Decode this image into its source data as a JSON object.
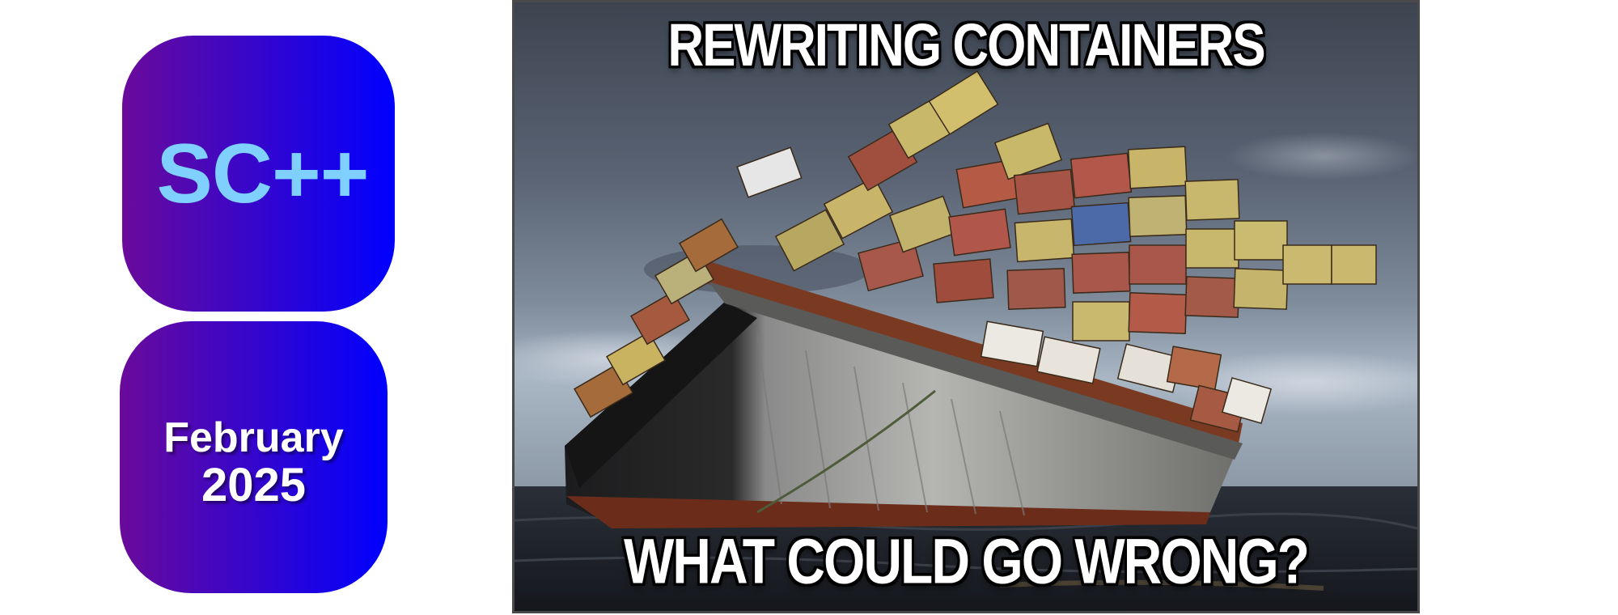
{
  "logo": {
    "text": "SC++",
    "text_color": "#7fd0ff",
    "gradient_start": "#6a0a9a",
    "gradient_end": "#0000ff"
  },
  "date_badge": {
    "month": "February",
    "year": "2025",
    "gradient_start": "#6a0a9a",
    "gradient_end": "#0000ff"
  },
  "meme": {
    "top_caption": "REWRITING CONTAINERS",
    "bottom_caption": "WHAT COULD GO WRONG?",
    "subject": "container-ship-listing-icon"
  }
}
